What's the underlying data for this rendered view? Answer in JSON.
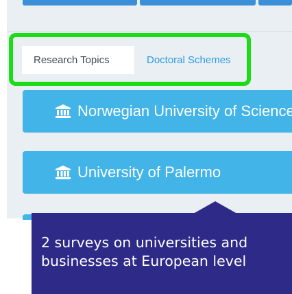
{
  "tabs": [
    {
      "label": "Research Topics",
      "active": true
    },
    {
      "label": "Doctoral Schemes",
      "active": false
    }
  ],
  "universities": [
    {
      "name": "Norwegian University of Science",
      "icon": "institution-icon"
    },
    {
      "name": "University of Palermo",
      "icon": "institution-icon"
    }
  ],
  "callout": {
    "line1": "2 surveys on universities and",
    "line2": "businesses at European level"
  },
  "colors": {
    "highlight": "#1cdc18",
    "button": "#43b4e7",
    "tab_link": "#2d9be0",
    "callout": "#2e2a88",
    "panel": "#e9eff3"
  }
}
